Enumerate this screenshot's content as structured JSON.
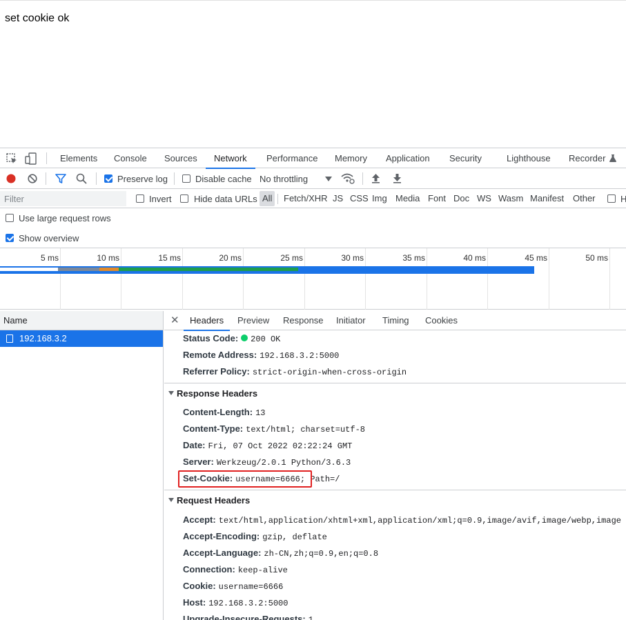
{
  "page": {
    "text": "set cookie ok"
  },
  "devtools": {
    "tabs": [
      "Elements",
      "Console",
      "Sources",
      "Network",
      "Performance",
      "Memory",
      "Application",
      "Security",
      "Lighthouse",
      "Recorder"
    ],
    "active_tab": "Network",
    "accent_color": "#1a73e8",
    "toolbar": {
      "record_icon": "record-icon",
      "clear_icon": "clear-icon",
      "filter_icon": "filter-icon",
      "search_icon": "search-icon",
      "preserve_log": {
        "label": "Preserve log",
        "checked": true
      },
      "disable_cache": {
        "label": "Disable cache",
        "checked": false
      },
      "throttling": "No throttling"
    },
    "filterbar": {
      "placeholder": "Filter",
      "invert": {
        "label": "Invert",
        "checked": false
      },
      "hide_data_urls": {
        "label": "Hide data URLs",
        "checked": false
      },
      "types": [
        "All",
        "Fetch/XHR",
        "JS",
        "CSS",
        "Img",
        "Media",
        "Font",
        "Doc",
        "WS",
        "Wasm",
        "Manifest",
        "Other"
      ],
      "trailing_label": "H"
    },
    "options": {
      "large_rows": {
        "label": "Use large request rows",
        "checked": false
      },
      "show_overview": {
        "label": "Show overview",
        "checked": true
      }
    },
    "overview_ticks": [
      "5 ms",
      "10 ms",
      "15 ms",
      "20 ms",
      "25 ms",
      "30 ms",
      "35 ms",
      "40 ms",
      "45 ms",
      "50 ms"
    ],
    "name_column": {
      "header": "Name",
      "rows": [
        "192.168.3.2"
      ]
    },
    "details": {
      "tabs": [
        "Headers",
        "Preview",
        "Response",
        "Initiator",
        "Timing",
        "Cookies"
      ],
      "active": "Headers",
      "general": [
        {
          "name": "Status Code:",
          "value": "200 OK"
        },
        {
          "name": "Remote Address:",
          "value": "192.168.3.2:5000"
        },
        {
          "name": "Referrer Policy:",
          "value": "strict-origin-when-cross-origin"
        }
      ],
      "response_title": "Response Headers",
      "response_headers": [
        {
          "name": "Content-Length:",
          "value": "13"
        },
        {
          "name": "Content-Type:",
          "value": "text/html; charset=utf-8"
        },
        {
          "name": "Date:",
          "value": "Fri, 07 Oct 2022 02:22:24 GMT"
        },
        {
          "name": "Server:",
          "value": "Werkzeug/2.0.1 Python/3.6.3"
        },
        {
          "name": "Set-Cookie:",
          "value": "username=6666; Path=/"
        }
      ],
      "request_title": "Request Headers",
      "request_headers": [
        {
          "name": "Accept:",
          "value": "text/html,application/xhtml+xml,application/xml;q=0.9,image/avif,image/webp,image"
        },
        {
          "name": "Accept-Encoding:",
          "value": "gzip, deflate"
        },
        {
          "name": "Accept-Language:",
          "value": "zh-CN,zh;q=0.9,en;q=0.8"
        },
        {
          "name": "Connection:",
          "value": "keep-alive"
        },
        {
          "name": "Cookie:",
          "value": "username=6666"
        },
        {
          "name": "Host:",
          "value": "192.168.3.2:5000"
        },
        {
          "name": "Upgrade-Insecure-Requests:",
          "value": "1"
        }
      ]
    }
  }
}
